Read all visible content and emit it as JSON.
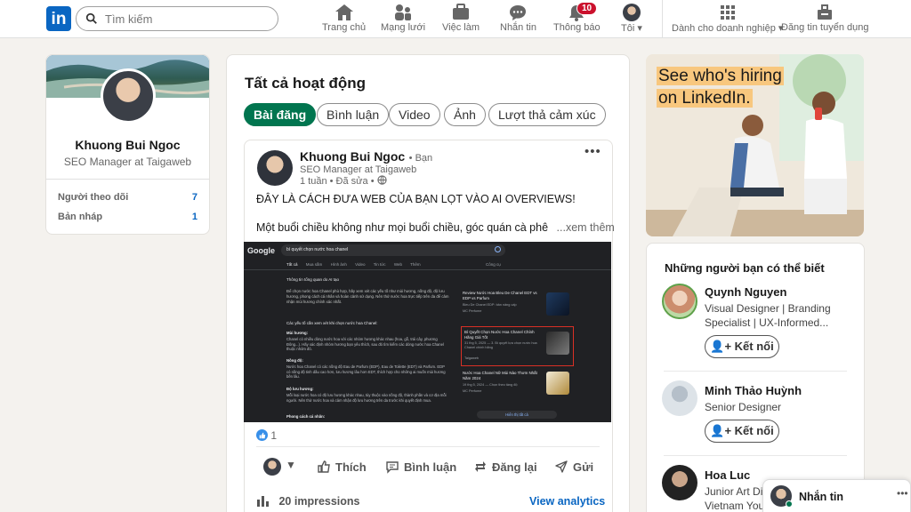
{
  "nav": {
    "search_placeholder": "Tìm kiếm",
    "items": [
      {
        "label": "Trang chủ",
        "icon": "home-icon"
      },
      {
        "label": "Mạng lưới",
        "icon": "network-icon"
      },
      {
        "label": "Việc làm",
        "icon": "jobs-icon"
      },
      {
        "label": "Nhắn tin",
        "icon": "messaging-icon"
      },
      {
        "label": "Thông báo",
        "icon": "bell-icon",
        "badge": "10"
      },
      {
        "label": "Tôi",
        "icon": "avatar"
      }
    ],
    "business": "Dành cho doanh nghiệp",
    "post_job": "Đăng tin tuyển dụng"
  },
  "profile": {
    "name": "Khuong Bui Ngoc",
    "title": "SEO Manager at Taigaweb",
    "stats": [
      {
        "label": "Người theo dõi",
        "value": "7"
      },
      {
        "label": "Bản nháp",
        "value": "1"
      }
    ]
  },
  "activity": {
    "heading": "Tất cả hoạt động",
    "filters": [
      "Bài đăng",
      "Bình luận",
      "Video",
      "Ảnh",
      "Lượt thả cảm xúc"
    ],
    "post": {
      "author": "Khuong Bui Ngoc",
      "relation": "• Bạn",
      "headline": "SEO Manager at Taigaweb",
      "meta": "1 tuần • Đã sửa •",
      "title": "ĐÂY LÀ CÁCH ĐƯA WEB CỦA BẠN LỌT VÀO AI OVERVIEWS!",
      "body": "Một buổi chiều không như mọi buổi chiều, góc quán cà phê",
      "see_more": "...xem thêm",
      "reactions": "1",
      "actions": [
        "Thích",
        "Bình luận",
        "Đăng lại",
        "Gửi"
      ],
      "impressions": "20 impressions",
      "view_analytics": "View analytics"
    }
  },
  "screenshot": {
    "brand": "Google",
    "query": "bí quyết chọn nước hoa chanel",
    "tabs": [
      "Tất cả",
      "Mua sắm",
      "Hình ảnh",
      "Video",
      "Tin tức",
      "Web",
      "Thêm"
    ],
    "tools": "Công cụ",
    "ai_label": "Thông tin tổng quan do AI tạo",
    "ai_intro": "Để chọn nước hoa Chanel phù hợp, hãy xem xét các yếu tố như mùi hương, nồng độ, độ lưu hương, phong cách cá nhân và hoàn cảnh sử dụng. Nên thử nước hoa trực tiếp trên da để cảm nhận mùi hương chính xác nhất.",
    "factors_heading": "Các yếu tố cần xem xét khi chọn nước hoa Chanel:",
    "f1": "Mùi hương:",
    "f1_text": "Chanel có nhiều dòng nước hoa với các nhóm hương khác nhau (hoa, gỗ, trái cây, phương Đông...). Hãy xác định nhóm hương bạn yêu thích, sau đó tìm kiếm các dòng nước hoa Chanel thuộc nhóm đó.",
    "f2": "Nồng độ:",
    "f2_text": "Nước hoa Chanel có các nồng độ Eau de Parfum (EDP), Eau de Toilette (EDT) và Parfum. EDP có nồng độ tinh dầu cao hơn, lưu hương lâu hơn EDT, thích hợp cho những ai muốn mùi hương bền lâu.",
    "f3": "Độ lưu hương:",
    "f3_text": "Mỗi loại nước hoa có độ lưu hương khác nhau, tùy thuộc vào nồng độ, thành phần và cơ địa mỗi người. Nên thử nước hoa và cảm nhận độ lưu hương trên da trước khi quyết định mua.",
    "f4": "Phong cách cá nhân:",
    "results": [
      {
        "title": "Review Nước Hoa Bleu De Chanel EDT vs EDP vs Parfum",
        "snippet": "Bleu De Chanel EDP: bản nâng cấp",
        "source": "MC Perfume"
      },
      {
        "title": "Bí Quyết Chọn Nước Hoa Chanel Chính Hãng Giá Tốt",
        "snippet": "31 thg 5, 2025 — 3. Bí quyết lựa chọn nước hoa Chanel chính hãng",
        "source": "Taigaweb"
      },
      {
        "title": "Nước Hoa Chanel Nữ Mùi Nào Thơm Nhất Năm 2024",
        "snippet": "19 thg 5, 2024 — Chọn theo tầng độ",
        "source": "MC Perfume"
      }
    ],
    "show_all": "Hiển thị tất cả"
  },
  "ad": {
    "headline_1": "See who's hiring",
    "headline_2": "on LinkedIn."
  },
  "pymk": {
    "heading": "Những người bạn có thể biết",
    "people": [
      {
        "name": "Quynh Nguyen",
        "sub1": "Visual Designer | Branding",
        "sub2": "Specialist | UX-Informed...",
        "connect": "Kết nối"
      },
      {
        "name": "Minh Thảo Huỳnh",
        "sub1": "Senior Designer",
        "sub2": "",
        "connect": "Kết nối"
      },
      {
        "name": "Hoa Luc",
        "sub1": "Junior Art Di",
        "sub2": "Vietnam You",
        "connect": ""
      }
    ]
  },
  "messaging": {
    "label": "Nhắn tin"
  },
  "colors": {
    "brand": "#0a66c2",
    "accent_green": "#01754f",
    "badge_red": "#cb112d"
  }
}
